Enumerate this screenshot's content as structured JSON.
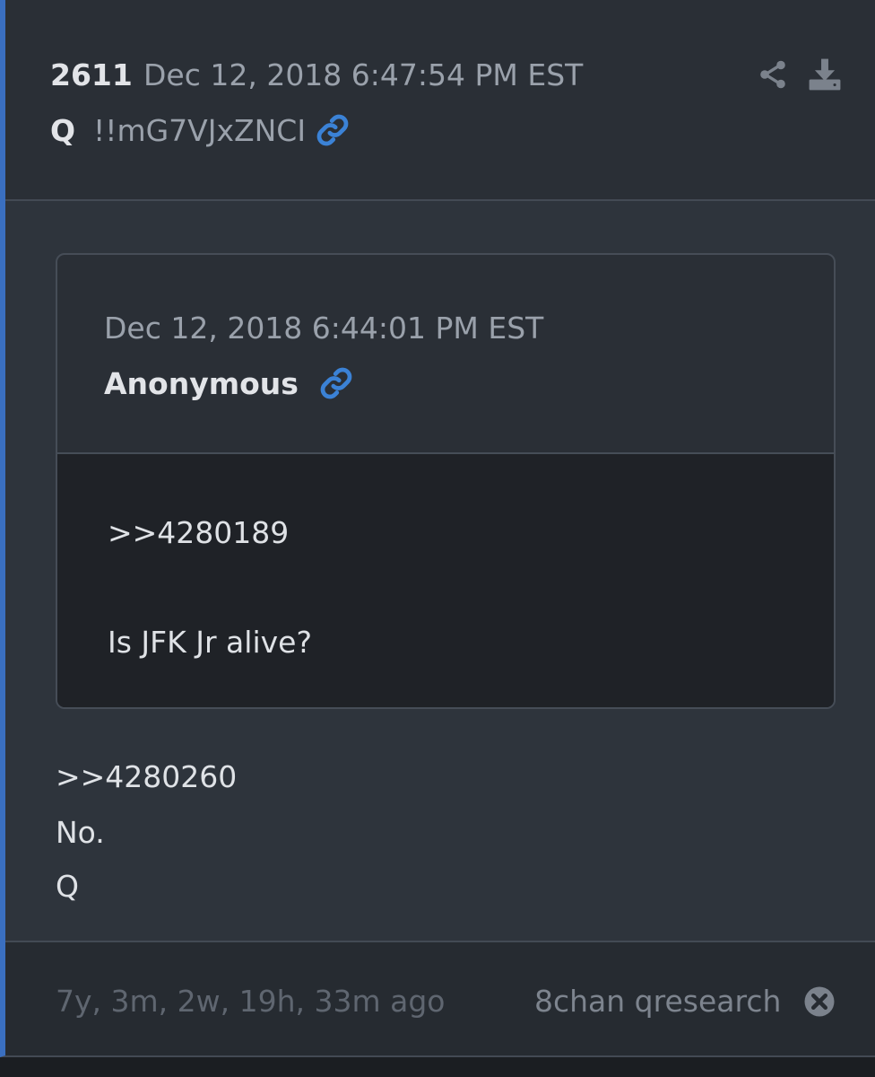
{
  "post": {
    "number": "2611",
    "date": "Dec 12, 2018 6:47:54 PM EST",
    "author": "Q",
    "tripcode": "!!mG7VJxZNCI",
    "icons": {
      "link": "link-icon",
      "share": "share-icon",
      "download": "download-icon"
    }
  },
  "quoted": {
    "date": "Dec 12, 2018 6:44:01 PM EST",
    "author": "Anonymous",
    "reference": ">>4280189",
    "text": "Is JFK Jr alive?"
  },
  "body": {
    "reference": ">>4280260",
    "line1": "No.",
    "line2": "Q"
  },
  "footer": {
    "elapsed": "7y, 3m, 2w, 19h, 33m ago",
    "source": "8chan qresearch",
    "close_icon": "close-circle-icon"
  },
  "colors": {
    "accent": "#3a6fc0",
    "link": "#3b82d6"
  }
}
